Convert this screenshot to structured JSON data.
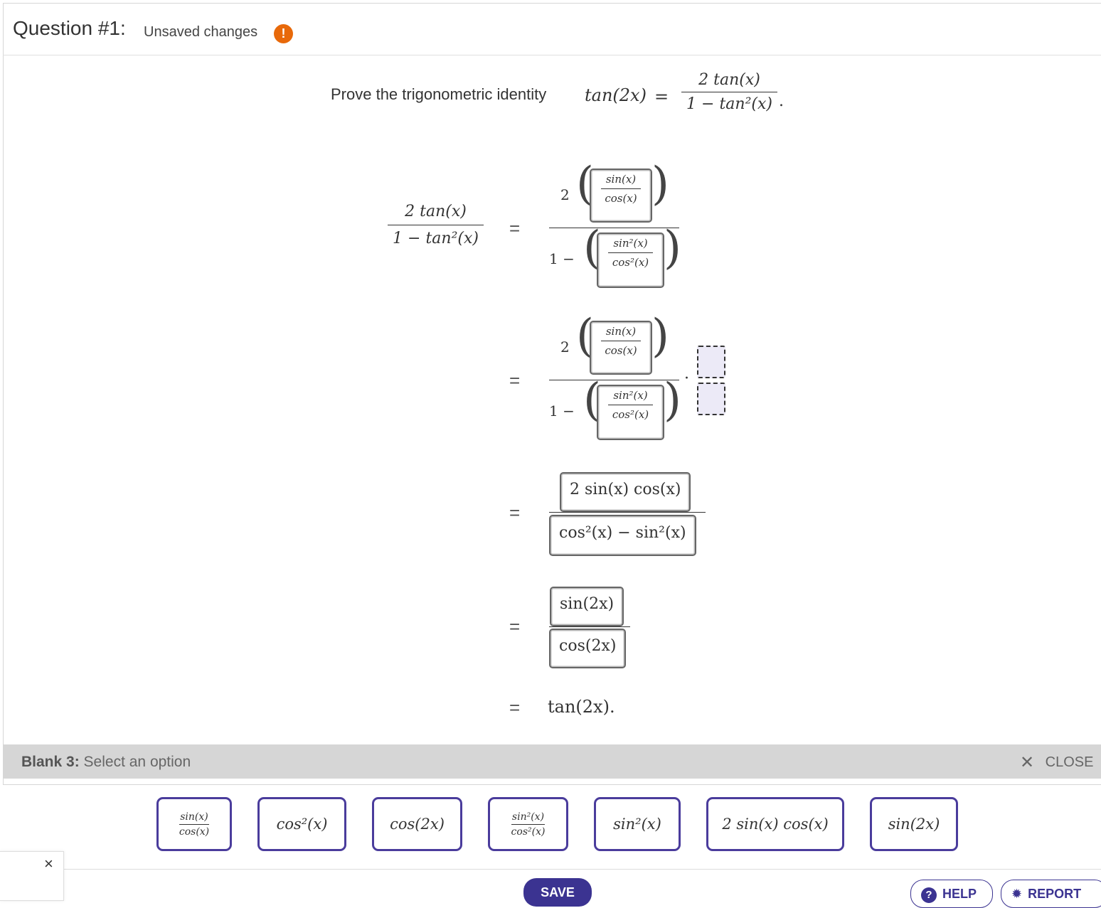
{
  "header": {
    "title": "Question #1:",
    "subtitle": "Unsaved changes",
    "warning_glyph": "!"
  },
  "prompt": {
    "text": "Prove the trigonometric identity",
    "lhs": "tan(2x)",
    "rhs_num": "2 tan(x)",
    "rhs_den": "1 − tan²(x)"
  },
  "proof": {
    "lhs_num": "2 tan(x)",
    "lhs_den": "1 − tan²(x)",
    "step1": {
      "coef": "2",
      "one": "1 −",
      "sin": "sin(x)",
      "cos": "cos(x)",
      "sin2": "sin²(x)",
      "cos2": "cos²(x)"
    },
    "step2": {
      "coef": "2",
      "one": "1 −",
      "sin": "sin(x)",
      "cos": "cos(x)",
      "sin2": "sin²(x)",
      "cos2": "cos²(x)",
      "dot": "·"
    },
    "step3": {
      "num": "2 sin(x) cos(x)",
      "den": "cos²(x) − sin²(x)"
    },
    "step4": {
      "num": "sin(2x)",
      "den": "cos(2x)"
    },
    "step5": {
      "result": "tan(2x)."
    },
    "equals": "="
  },
  "blank_bar": {
    "label": "Blank 3:",
    "hint": "Select an option",
    "close_label": "CLOSE",
    "close_glyph": "✕"
  },
  "options": [
    {
      "num": "sin(x)",
      "den": "cos(x)"
    },
    {
      "text": "cos²(x)"
    },
    {
      "text": "cos(2x)"
    },
    {
      "num": "sin²(x)",
      "den": "cos²(x)"
    },
    {
      "text": "sin²(x)"
    },
    {
      "text": "2 sin(x) cos(x)"
    },
    {
      "text": "sin(2x)"
    }
  ],
  "footer": {
    "save": "SAVE",
    "help": "HELP",
    "help_glyph": "?",
    "report": "REPORT",
    "report_glyph": "✹",
    "side_close": "×"
  }
}
